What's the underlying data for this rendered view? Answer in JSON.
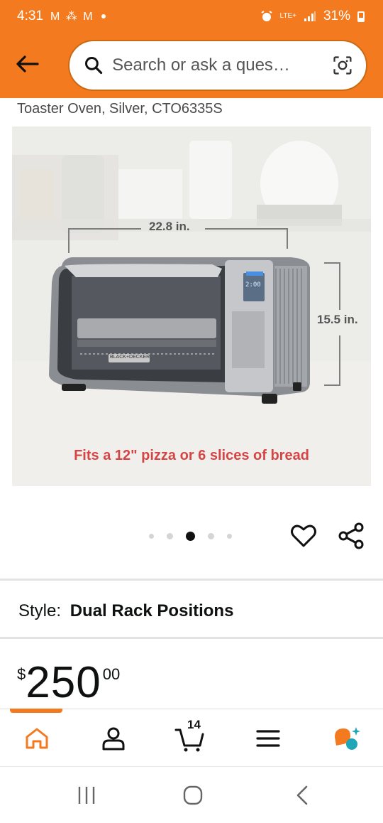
{
  "status_bar": {
    "time": "4:31",
    "notification_icons": "M ⁂ M",
    "network": "LTE+",
    "battery": "31%"
  },
  "header": {
    "search_placeholder": "Search or ask a ques…",
    "accent_color": "#f47a1f"
  },
  "product": {
    "title": "Toaster Oven, Silver, CTO6335S",
    "image": {
      "width_label": "22.8 in.",
      "height_label": "15.5 in.",
      "caption": "Fits a 12\" pizza or 6 slices of bread",
      "brand_plate": "BLACK+DECKER",
      "display_readout": "2:00"
    },
    "carousel": {
      "total": 5,
      "active_index": 2
    },
    "style_label": "Style:",
    "style_value": "Dual Rack Positions",
    "price": {
      "symbol": "$",
      "whole": "250",
      "fraction": "00"
    }
  },
  "bottom_nav": {
    "items": [
      "home-icon",
      "account-icon",
      "cart-icon",
      "menu-icon",
      "rufus-icon"
    ],
    "cart_count": "14",
    "active": "home"
  },
  "system_nav": [
    "recents-icon",
    "home-circle-icon",
    "back-chevron-icon"
  ]
}
